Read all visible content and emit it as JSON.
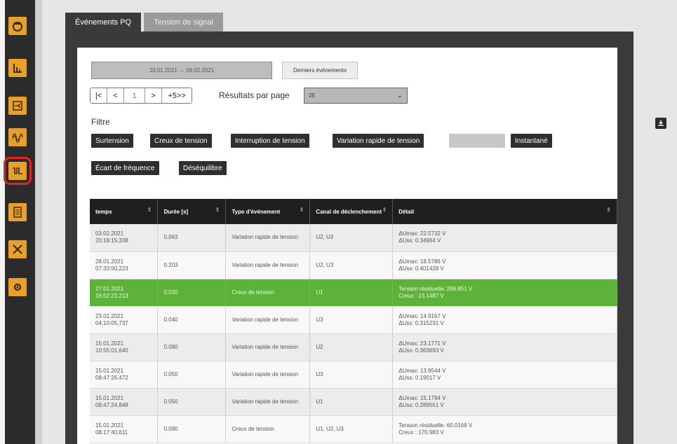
{
  "tabs": [
    {
      "label": "Événements PQ"
    },
    {
      "label": "Tension de signal"
    }
  ],
  "controls": {
    "date_range": "10.01.2021 → 09.02.2021",
    "last_events_label": "Derniers événements",
    "pager": {
      "first": "|<",
      "prev": "<",
      "page": "1",
      "next": ">",
      "more": "+5>>"
    },
    "per_page_label": "Résultats par page",
    "per_page_value": "25",
    "filter_label": "Filtre"
  },
  "filters": [
    "Surtension",
    "Creux de tension",
    "Interruption de tension",
    "Variation rapide de tension",
    "",
    "Instantané",
    "Écart de fréquence",
    "Déséquilibre"
  ],
  "table": {
    "headers": [
      "temps",
      "Durée [s]",
      "Type d'événement",
      "Canal de déclenchement",
      "Détail"
    ],
    "rows": [
      {
        "time1": "03.02.2021",
        "time2": "20:18:15,338",
        "duration": "0.063",
        "type": "Variation rapide de tension",
        "channel": "U2, U3",
        "detail1": "ΔUmax: 22.5732 V",
        "detail2": "ΔUss: 0.34964 V",
        "highlight": false
      },
      {
        "time1": "28.01.2021",
        "time2": "07:33:50,223",
        "duration": "0.203",
        "type": "Variation rapide de tension",
        "channel": "U2, U3",
        "detail1": "ΔUmax: 18.5786 V",
        "detail2": "ΔUss: 0.401428 V",
        "highlight": false
      },
      {
        "time1": "27.01.2021",
        "time2": "16:52:23,213",
        "duration": "0.020",
        "type": "Creux de tension",
        "channel": "U1",
        "detail1": "Tension résiduelle: 206.851 V",
        "detail2": "Creux : 23.1487 V",
        "highlight": true
      },
      {
        "time1": "23.01.2021",
        "time2": "04:10:05,737",
        "duration": "0.040",
        "type": "Variation rapide de tension",
        "channel": "U3",
        "detail1": "ΔUmax: 14.9167 V",
        "detail2": "ΔUss: 0.315231 V",
        "highlight": false
      },
      {
        "time1": "15.01.2021",
        "time2": "10:55:01,640",
        "duration": "0.080",
        "type": "Variation rapide de tension",
        "channel": "U2",
        "detail1": "ΔUmax: 23.1771 V",
        "detail2": "ΔUss: 0.363693 V",
        "highlight": false
      },
      {
        "time1": "15.01.2021",
        "time2": "08:47:26,472",
        "duration": "0.050",
        "type": "Variation rapide de tension",
        "channel": "U3",
        "detail1": "ΔUmax: 13.9544 V",
        "detail2": "ΔUss: 0.19017 V",
        "highlight": false
      },
      {
        "time1": "15.01.2021",
        "time2": "08:47:24,848",
        "duration": "0.050",
        "type": "Variation rapide de tension",
        "channel": "U1",
        "detail1": "ΔUmax: 15.1794 V",
        "detail2": "ΔUss: 0.289551 V",
        "highlight": false
      },
      {
        "time1": "15.01.2021",
        "time2": "08:17:40,611",
        "duration": "0.090",
        "type": "Creux de tension",
        "channel": "U1, U2, U3",
        "detail1": "Tension résiduelle: 60.0168 V",
        "detail2": "Creux : 170.983 V",
        "highlight": false
      }
    ]
  },
  "sidebar": {
    "icons": [
      "dashboard-icon",
      "bar-chart-icon",
      "network-icon",
      "waveform-harmonics-icon",
      "signal-wave-icon",
      "document-icon",
      "tools-icon",
      "settings-gear-icon"
    ],
    "active_index": 4
  }
}
